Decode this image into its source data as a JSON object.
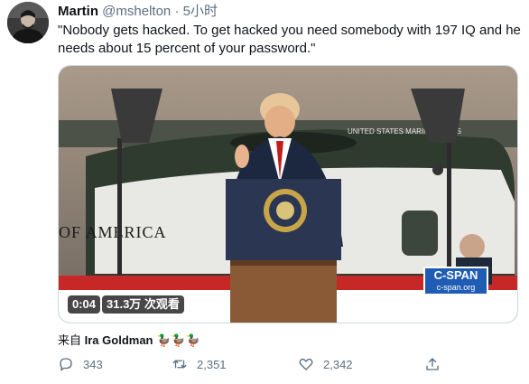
{
  "tweet": {
    "author_name": "Martin",
    "author_handle": "@mshelton",
    "separator": "·",
    "time": "5小时",
    "text": "\"Nobody gets hacked. To get hacked you need somebody with 197 IQ and he needs about 15 percent of your password.\""
  },
  "video": {
    "duration": "0:04",
    "views": "31.3万 次观看",
    "background_sign": "OF AMERICA",
    "helicopter_text": "UNITED STATES MARINE CORPS",
    "network_logo": "C-SPAN",
    "network_url": "c-span.org"
  },
  "credit": {
    "prefix": "来自",
    "name": "Ira Goldman",
    "emoji": "🦆🦆🦆"
  },
  "actions": {
    "reply_count": "343",
    "retweet_count": "2,351",
    "like_count": "2,342"
  },
  "colors": {
    "text": "#0f1419",
    "secondary": "#5b7083",
    "cspan_blue": "#1f5db5"
  }
}
